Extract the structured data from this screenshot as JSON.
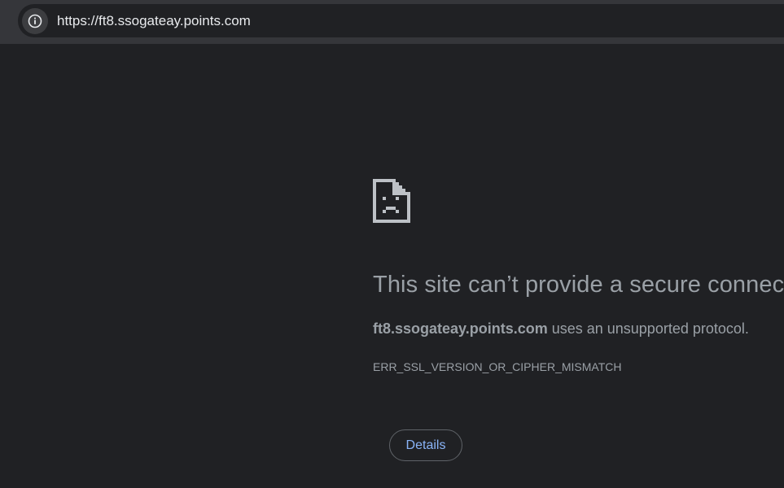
{
  "browser": {
    "url": "https://ft8.ssogateay.points.com",
    "info_icon": "info-icon"
  },
  "error_page": {
    "icon": "sad-page-icon",
    "heading": "This site can’t provide a secure connection",
    "host": "ft8.ssogateay.points.com",
    "summary_suffix": " uses an unsupported protocol.",
    "error_code": "ERR_SSL_VERSION_OR_CIPHER_MISMATCH",
    "details_label": "Details"
  },
  "colors": {
    "page_background": "#202124",
    "toolbar_background": "#35363a",
    "text_secondary": "#9aa0a6",
    "link_blue": "#8ab4f8"
  }
}
